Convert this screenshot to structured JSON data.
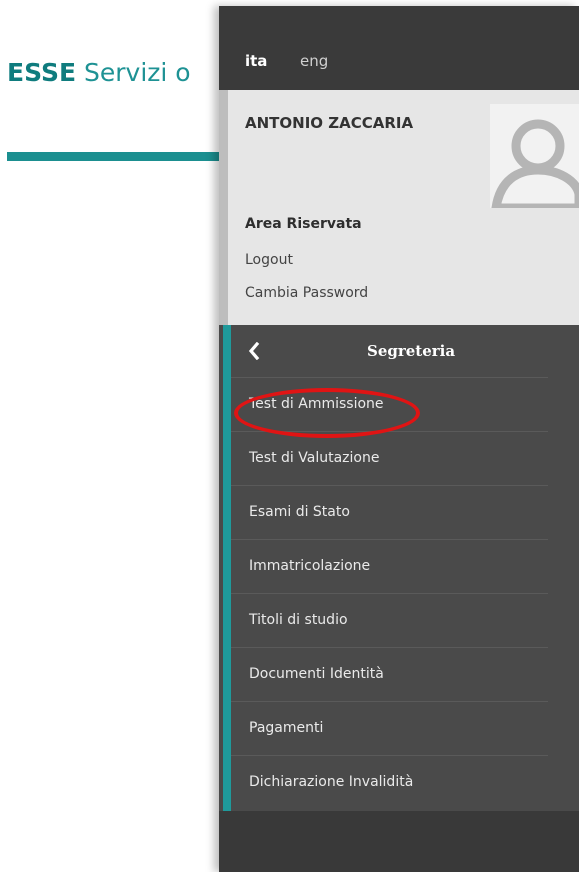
{
  "background": {
    "brand_strong": "ESSE",
    "brand_rest": "Servizi o"
  },
  "drawer": {
    "languages": [
      {
        "label": "ita",
        "active": true
      },
      {
        "label": "eng",
        "active": false
      }
    ],
    "user": {
      "name": "ANTONIO ZACCARIA",
      "avatar_icon": "user-silhouette-icon",
      "area_title": "Area Riservata",
      "logout": "Logout",
      "change_password": "Cambia Password"
    },
    "menu": {
      "back_icon": "chevron-left-icon",
      "title": "Segreteria",
      "items": [
        {
          "label": "Test di Ammissione",
          "highlighted": true
        },
        {
          "label": "Test di Valutazione"
        },
        {
          "label": "Esami di Stato"
        },
        {
          "label": "Immatricolazione"
        },
        {
          "label": "Titoli di studio"
        },
        {
          "label": "Documenti Identità"
        },
        {
          "label": "Pagamenti"
        },
        {
          "label": "Dichiarazione Invalidità"
        }
      ]
    }
  },
  "colors": {
    "brand_teal": "#0f7c7e",
    "accent_teal": "#1f9a9b",
    "drawer_dark": "#4a4a4a",
    "highlight_red": "#e01414"
  }
}
